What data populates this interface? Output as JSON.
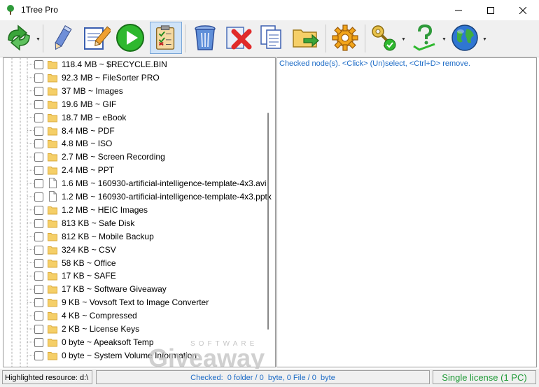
{
  "window": {
    "title": "1Tree Pro",
    "controls": [
      "minimize-icon",
      "maximize-icon",
      "close-icon"
    ]
  },
  "toolbar": {
    "buttons": [
      {
        "name": "refresh-button",
        "icon": "recycle-arrows-icon",
        "has_dropdown": true
      },
      {
        "name": "pen-button",
        "icon": "pencil-icon",
        "has_dropdown": false
      },
      {
        "name": "edit-button",
        "icon": "edit-document-icon",
        "has_dropdown": false
      },
      {
        "name": "play-button",
        "icon": "play-icon",
        "has_dropdown": false
      },
      {
        "name": "checklist-button",
        "icon": "checklist-icon",
        "has_dropdown": false,
        "pressed": true
      },
      {
        "name": "trash-button",
        "icon": "trash-can-icon",
        "has_dropdown": false
      },
      {
        "name": "delete-button",
        "icon": "delete-x-icon",
        "has_dropdown": false
      },
      {
        "name": "copy-button",
        "icon": "copy-icon",
        "has_dropdown": false
      },
      {
        "name": "move-button",
        "icon": "move-folder-icon",
        "has_dropdown": false
      },
      {
        "name": "settings-button",
        "icon": "gear-icon",
        "has_dropdown": false
      },
      {
        "name": "license-button",
        "icon": "key-icon",
        "has_dropdown": true
      },
      {
        "name": "help-button",
        "icon": "help-icon",
        "has_dropdown": true
      },
      {
        "name": "web-button",
        "icon": "globe-icon",
        "has_dropdown": true
      }
    ]
  },
  "tree": {
    "items": [
      {
        "label": "118.4 MB ~ $RECYCLE.BIN",
        "type": "folder"
      },
      {
        "label": "92.3 MB ~ FileSorter PRO",
        "type": "folder"
      },
      {
        "label": "37 MB ~ Images",
        "type": "folder"
      },
      {
        "label": "19.6 MB ~ GIF",
        "type": "folder"
      },
      {
        "label": "18.7 MB ~ eBook",
        "type": "folder"
      },
      {
        "label": "8.4 MB ~ PDF",
        "type": "folder"
      },
      {
        "label": "4.8 MB ~ ISO",
        "type": "folder"
      },
      {
        "label": "2.7 MB ~ Screen Recording",
        "type": "folder"
      },
      {
        "label": "2.4 MB ~ PPT",
        "type": "folder"
      },
      {
        "label": "1.6 MB ~ 160930-artificial-intelligence-template-4x3.avi",
        "type": "file"
      },
      {
        "label": "1.2 MB ~ 160930-artificial-intelligence-template-4x3.pptx",
        "type": "file"
      },
      {
        "label": "1.2 MB ~ HEIC Images",
        "type": "folder"
      },
      {
        "label": "813 KB ~ Safe Disk",
        "type": "folder"
      },
      {
        "label": "812 KB ~ Mobile Backup",
        "type": "folder"
      },
      {
        "label": "324 KB ~ CSV",
        "type": "folder"
      },
      {
        "label": "58 KB ~ Office",
        "type": "folder"
      },
      {
        "label": "17 KB ~ SAFE",
        "type": "folder"
      },
      {
        "label": "17 KB ~ Software Giveaway",
        "type": "folder"
      },
      {
        "label": "9 KB ~ Vovsoft Text to Image Converter",
        "type": "folder"
      },
      {
        "label": "4 KB ~ Compressed",
        "type": "folder"
      },
      {
        "label": "2 KB ~ License Keys",
        "type": "folder"
      },
      {
        "label": "0 byte ~ Apeaksoft Temp",
        "type": "folder"
      },
      {
        "label": "0 byte ~ System Volume Information",
        "type": "folder"
      }
    ]
  },
  "info_panel": {
    "text": "Checked node(s). <Click> (Un)select, <Ctrl+D> remove."
  },
  "statusbar": {
    "highlighted": "Highlighted resource: d:\\",
    "checked": "Checked:  0 folder / 0  byte, 0 File / 0  byte",
    "license": "Single license (1 PC)"
  },
  "watermark": {
    "line1": "SOFTWARE",
    "line2": "Giveaway"
  },
  "colors": {
    "info_text": "#1c6bc6",
    "license_text": "#1e9a36",
    "folder": "#f5cf68"
  }
}
